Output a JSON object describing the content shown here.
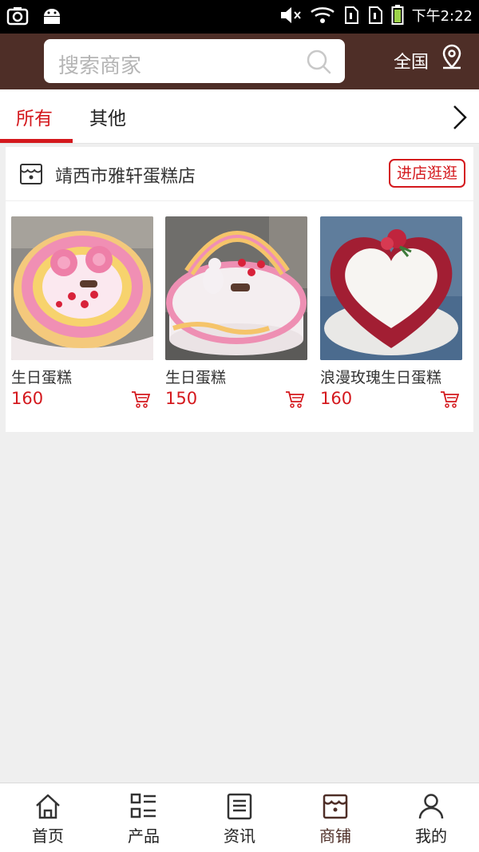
{
  "status_bar": {
    "time": "下午2:22"
  },
  "header": {
    "search_placeholder": "搜索商家",
    "region": "全国"
  },
  "tabs": [
    {
      "label": "所有",
      "active": true
    },
    {
      "label": "其他",
      "active": false
    }
  ],
  "shop": {
    "name": "靖西市雅轩蛋糕店",
    "enter_button": "进店逛逛"
  },
  "products": [
    {
      "name": "生日蛋糕",
      "price": "160"
    },
    {
      "name": "生日蛋糕",
      "price": "150"
    },
    {
      "name": "浪漫玫瑰生日蛋糕",
      "price": "160"
    }
  ],
  "bottom_nav": [
    {
      "label": "首页",
      "icon": "home-icon"
    },
    {
      "label": "产品",
      "icon": "list-icon"
    },
    {
      "label": "资讯",
      "icon": "news-icon"
    },
    {
      "label": "商铺",
      "icon": "store-icon",
      "active": true
    },
    {
      "label": "我的",
      "icon": "user-icon"
    }
  ],
  "colors": {
    "brand": "#4e2e27",
    "accent": "#d4181d"
  }
}
